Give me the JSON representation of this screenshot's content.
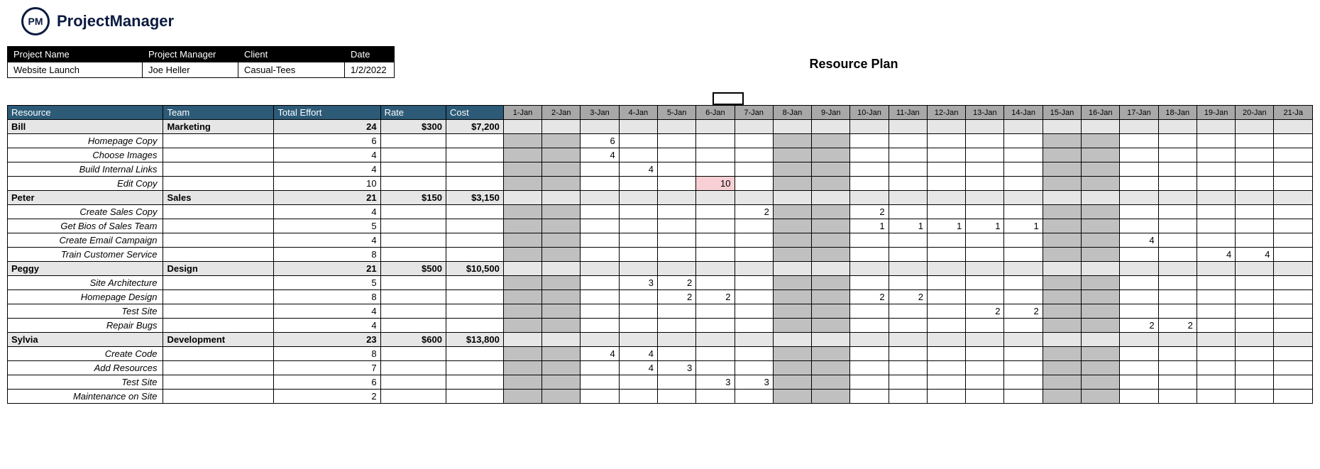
{
  "logo": {
    "badge": "PM",
    "text": "ProjectManager"
  },
  "title": "Resource Plan",
  "meta": {
    "headers": {
      "project": "Project Name",
      "manager": "Project Manager",
      "client": "Client",
      "date": "Date"
    },
    "values": {
      "project": "Website Launch",
      "manager": "Joe Heller",
      "client": "Casual-Tees",
      "date": "1/2/2022"
    }
  },
  "columns": {
    "resource": "Resource",
    "team": "Team",
    "effort": "Total Effort",
    "rate": "Rate",
    "cost": "Cost"
  },
  "dates": [
    "1-Jan",
    "2-Jan",
    "3-Jan",
    "4-Jan",
    "5-Jan",
    "6-Jan",
    "7-Jan",
    "8-Jan",
    "9-Jan",
    "10-Jan",
    "11-Jan",
    "12-Jan",
    "13-Jan",
    "14-Jan",
    "15-Jan",
    "16-Jan",
    "17-Jan",
    "18-Jan",
    "19-Jan",
    "20-Jan",
    "21-Ja"
  ],
  "weekendCols": [
    0,
    1,
    7,
    8,
    14,
    15
  ],
  "groups": [
    {
      "name": "Bill",
      "team": "Marketing",
      "effort": "24",
      "rate": "$300",
      "cost": "$7,200",
      "tasks": [
        {
          "name": "Homepage Copy",
          "effort": "6",
          "cells": {
            "2": "6"
          }
        },
        {
          "name": "Choose Images",
          "effort": "4",
          "cells": {
            "2": "4"
          }
        },
        {
          "name": "Build Internal Links",
          "effort": "4",
          "cells": {
            "3": "4"
          }
        },
        {
          "name": "Edit Copy",
          "effort": "10",
          "cells": {
            "5": "10"
          },
          "highlight": {
            "5": "pink"
          }
        }
      ]
    },
    {
      "name": "Peter",
      "team": "Sales",
      "effort": "21",
      "rate": "$150",
      "cost": "$3,150",
      "tasks": [
        {
          "name": "Create Sales Copy",
          "effort": "4",
          "cells": {
            "6": "2",
            "9": "2"
          }
        },
        {
          "name": "Get Bios of Sales Team",
          "effort": "5",
          "cells": {
            "9": "1",
            "10": "1",
            "11": "1",
            "12": "1",
            "13": "1"
          }
        },
        {
          "name": "Create Email Campaign",
          "effort": "4",
          "cells": {
            "16": "4"
          }
        },
        {
          "name": "Train Customer Service",
          "effort": "8",
          "cells": {
            "18": "4",
            "19": "4"
          }
        }
      ]
    },
    {
      "name": "Peggy",
      "team": "Design",
      "effort": "21",
      "rate": "$500",
      "cost": "$10,500",
      "tasks": [
        {
          "name": "Site Architecture",
          "effort": "5",
          "cells": {
            "3": "3",
            "4": "2"
          }
        },
        {
          "name": "Homepage Design",
          "effort": "8",
          "cells": {
            "4": "2",
            "5": "2",
            "9": "2",
            "10": "2"
          }
        },
        {
          "name": "Test Site",
          "effort": "4",
          "cells": {
            "12": "2",
            "13": "2"
          }
        },
        {
          "name": "Repair Bugs",
          "effort": "4",
          "cells": {
            "16": "2",
            "17": "2"
          }
        }
      ]
    },
    {
      "name": "Sylvia",
      "team": "Development",
      "effort": "23",
      "rate": "$600",
      "cost": "$13,800",
      "tasks": [
        {
          "name": "Create Code",
          "effort": "8",
          "cells": {
            "2": "4",
            "3": "4"
          }
        },
        {
          "name": "Add Resources",
          "effort": "7",
          "cells": {
            "3": "4",
            "4": "3"
          }
        },
        {
          "name": "Test Site",
          "effort": "6",
          "cells": {
            "5": "3",
            "6": "3"
          }
        },
        {
          "name": "Maintenance on Site",
          "effort": "2",
          "cells": {}
        }
      ]
    }
  ]
}
